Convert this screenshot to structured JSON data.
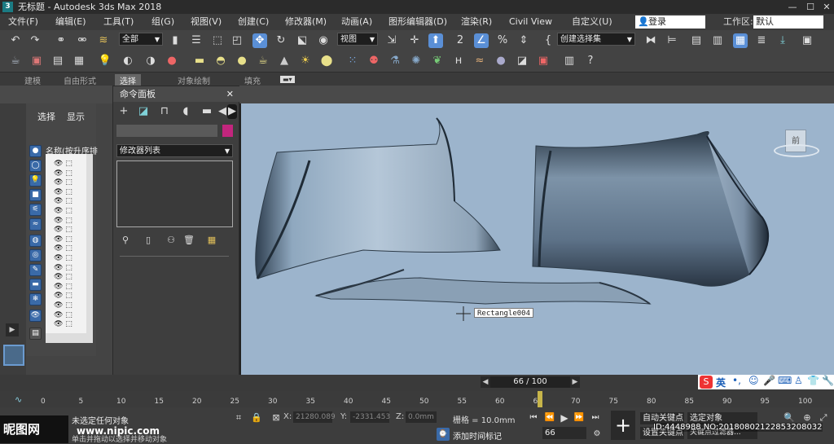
{
  "window": {
    "title": "无标题 - Autodesk 3ds Max 2018",
    "app_icon": "3"
  },
  "menu": {
    "items": [
      "文件(F)",
      "编辑(E)",
      "工具(T)",
      "组(G)",
      "视图(V)",
      "创建(C)",
      "修改器(M)",
      "动画(A)",
      "图形编辑器(D)",
      "渲染(R)",
      "Civil View",
      "自定义(U)"
    ],
    "login": "登录",
    "workspace_label": "工作区:",
    "workspace_value": "默认"
  },
  "toolbar1": {
    "filter_select": "全部",
    "refcoord_select": "视图",
    "named_selection": "创建选择集"
  },
  "ribbon": {
    "tabs": [
      "建模",
      "自由形式",
      "选择",
      "对象绘制",
      "填充"
    ]
  },
  "scene_explorer": {
    "tab_select": "选择",
    "tab_display": "显示",
    "name_header": "名称(按升序排"
  },
  "command_panel": {
    "title": "命令面板",
    "modifier_list": "修改器列表",
    "color_swatch": "#c2257d"
  },
  "viewport": {
    "viewcube_label": "前",
    "object_tooltip": "Rectangle004"
  },
  "timeline": {
    "frame_display": "66 / 100",
    "ticks": [
      "0",
      "5",
      "10",
      "15",
      "20",
      "25",
      "30",
      "35",
      "40",
      "45",
      "50",
      "55",
      "60",
      "65",
      "70",
      "75",
      "80",
      "85",
      "90",
      "95",
      "100"
    ],
    "current_frame": 66
  },
  "status": {
    "selection_text": "未选定任何对象",
    "prompt_text": "单击并拖动以选择并移动对象",
    "x_label": "X:",
    "x_value": "21280.089",
    "y_label": "Y:",
    "y_value": "-2331.453",
    "z_label": "Z:",
    "z_value": "0.0mm",
    "grid_text": "栅格 = 10.0mm",
    "add_time_tag": "添加时间标记",
    "auto_key": "自动关键点",
    "set_key": "设置关键点",
    "selected_object": "选定对象",
    "key_filters": "关键点过滤器...",
    "frame_input": "66"
  },
  "watermark": {
    "site_logo": "昵图网",
    "site_url": "www.nipic.com",
    "id_text": "ID:4448988 NO:20180802122853208032"
  },
  "ime": {
    "label": "英"
  }
}
